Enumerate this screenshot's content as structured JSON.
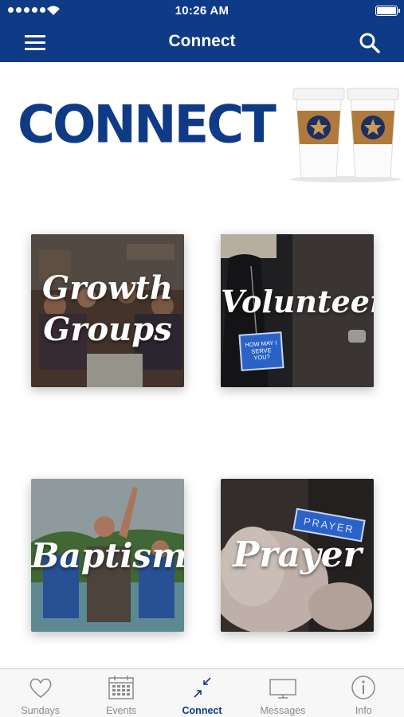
{
  "status_bar": {
    "time": "10:26 AM"
  },
  "nav": {
    "title": "Connect",
    "menu_icon": "hamburger-menu-icon",
    "search_icon": "search-icon"
  },
  "banner": {
    "text": "CONNECT",
    "image": "coffee-cups-image"
  },
  "tiles": [
    {
      "label_line1": "Growth",
      "label_line2": "Groups"
    },
    {
      "label_line1": "Volunteer",
      "badge": "HOW MAY I SERVE YOU?"
    },
    {
      "label_line1": "Baptism"
    },
    {
      "label_line1": "Prayer",
      "badge": "PRAYER"
    }
  ],
  "tabbar": {
    "items": [
      {
        "label": "Sundays",
        "icon": "heart-icon"
      },
      {
        "label": "Events",
        "icon": "calendar-icon"
      },
      {
        "label": "Connect",
        "icon": "connect-arrows-icon",
        "active": true
      },
      {
        "label": "Messages",
        "icon": "monitor-icon"
      },
      {
        "label": "Info",
        "icon": "info-icon"
      }
    ]
  },
  "colors": {
    "brand": "#0f3a86",
    "tab_inactive": "#8a8a8a",
    "tabbar_bg": "#f7f7f7"
  }
}
